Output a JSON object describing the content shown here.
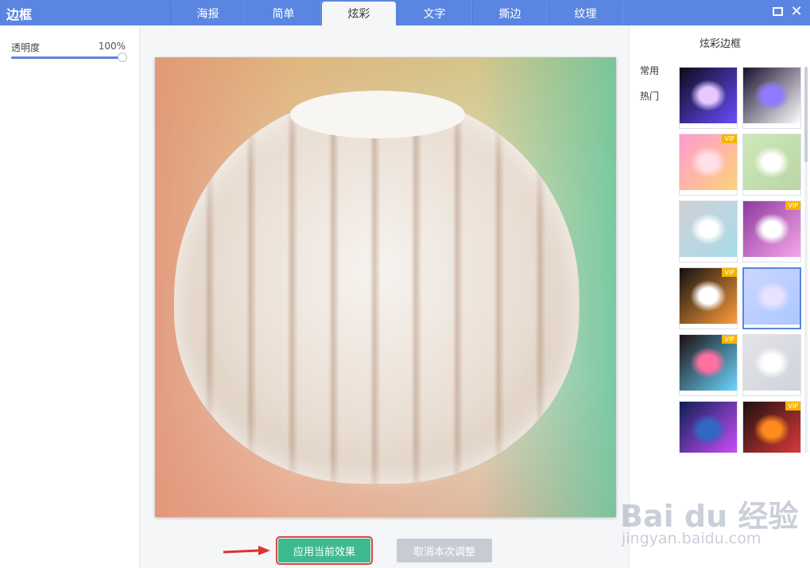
{
  "app": {
    "title": "边框"
  },
  "tabs": [
    {
      "label": "海报",
      "active": false
    },
    {
      "label": "简单",
      "active": false
    },
    {
      "label": "炫彩",
      "active": true
    },
    {
      "label": "文字",
      "active": false
    },
    {
      "label": "撕边",
      "active": false
    },
    {
      "label": "纹理",
      "active": false
    }
  ],
  "window_controls": {
    "maximize_icon": "maximize-icon",
    "close_icon": "close-icon"
  },
  "left_panel": {
    "opacity_label": "透明度",
    "opacity_value": "100%",
    "opacity_level": 1.0
  },
  "actions": {
    "apply_label": "应用当前效果",
    "cancel_label": "取消本次调整"
  },
  "right_panel": {
    "title": "炫彩边框",
    "categories": [
      "常用",
      "热门"
    ],
    "thumbnails": [
      {
        "vip": false,
        "selected": false,
        "colors": [
          "#0b0b1a",
          "#e8c9ff",
          "#6a4cff"
        ]
      },
      {
        "vip": false,
        "selected": false,
        "colors": [
          "#1a0f30",
          "#8f7bff",
          "#ffffff"
        ]
      },
      {
        "vip": true,
        "selected": false,
        "colors": [
          "#ff9bd0",
          "#ffe0e8",
          "#ffd27a"
        ]
      },
      {
        "vip": false,
        "selected": false,
        "colors": [
          "#cfe8b8",
          "#ffffff",
          "#b9d6a4"
        ]
      },
      {
        "vip": false,
        "selected": false,
        "colors": [
          "#d0d0d6",
          "#ffffff",
          "#a8dcea"
        ]
      },
      {
        "vip": true,
        "selected": false,
        "colors": [
          "#8c3aa0",
          "#ffffff",
          "#f7a6e8"
        ]
      },
      {
        "vip": true,
        "selected": false,
        "colors": [
          "#111111",
          "#ffffff",
          "#ff9d3a"
        ]
      },
      {
        "vip": false,
        "selected": true,
        "colors": [
          "#cdd6ff",
          "#e6e2ff",
          "#a9c7ff"
        ]
      },
      {
        "vip": true,
        "selected": false,
        "colors": [
          "#1a1010",
          "#ff6fa0",
          "#6bd6ff"
        ]
      },
      {
        "vip": false,
        "selected": false,
        "colors": [
          "#e4e4e8",
          "#ffffff",
          "#cfd3dc"
        ]
      },
      {
        "vip": false,
        "selected": false,
        "colors": [
          "#0c1f55",
          "#2f69c4",
          "#d34fff"
        ]
      },
      {
        "vip": true,
        "selected": false,
        "colors": [
          "#1d1010",
          "#ff8a1e",
          "#e23b3b"
        ]
      }
    ],
    "vip_label": "VIP"
  },
  "watermark": {
    "brand": "Bai du 经验",
    "sub": "jingyan.baidu.com"
  },
  "colors": {
    "accent": "#5a86e2",
    "apply": "#3dbb8e",
    "cancel": "#c7cbd2",
    "highlight": "#e0433f"
  }
}
